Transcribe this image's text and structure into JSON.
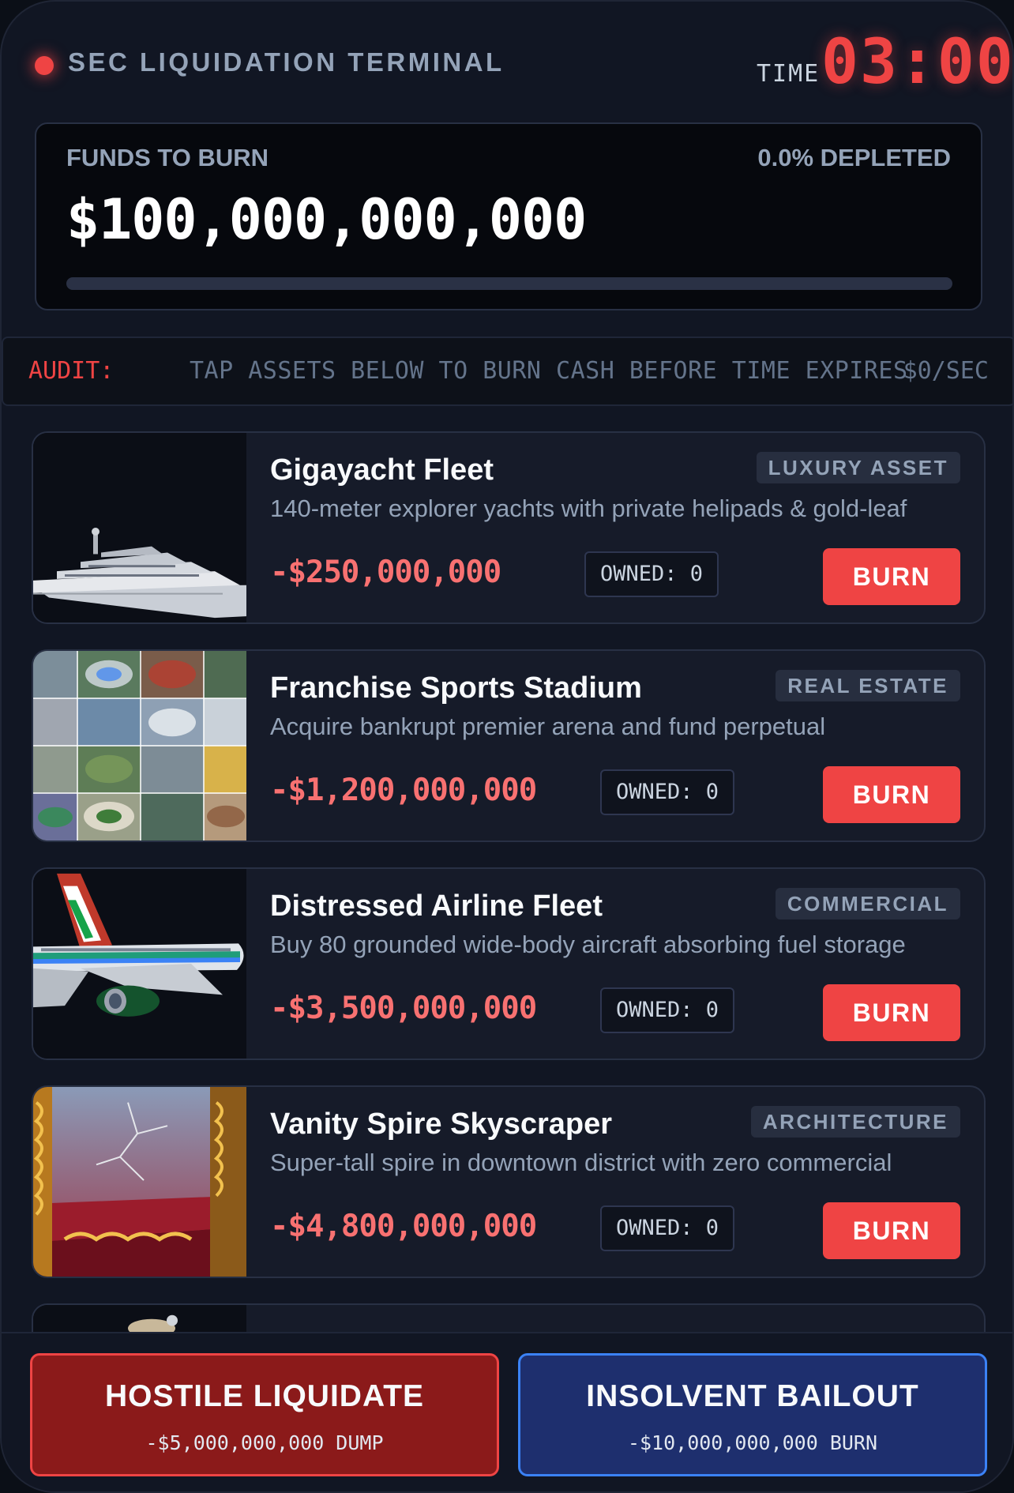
{
  "header": {
    "title": "SEC LIQUIDATION TERMINAL",
    "time_label": "TIME",
    "timer": "03:00"
  },
  "funds": {
    "label": "FUNDS TO BURN",
    "depleted": "0.0% DEPLETED",
    "depleted_fraction": 0.0,
    "amount": "$100,000,000,000"
  },
  "audit": {
    "label": "AUDIT:",
    "message": "TAP ASSETS BELOW TO BURN CASH BEFORE TIME EXPIRES",
    "rate": "$0/SEC"
  },
  "assets": [
    {
      "name": "Gigayacht Fleet",
      "tag": "LUXURY ASSET",
      "description": "140-meter explorer yachts with private helipads & gold-leaf",
      "price": "-$250,000,000",
      "owned": "OWNED: 0",
      "burn_label": "BURN",
      "image_icon": "yacht-image"
    },
    {
      "name": "Franchise Sports Stadium",
      "tag": "REAL ESTATE",
      "description": "Acquire bankrupt premier arena and fund perpetual",
      "price": "-$1,200,000,000",
      "owned": "OWNED: 0",
      "burn_label": "BURN",
      "image_icon": "stadium-collage-image"
    },
    {
      "name": "Distressed Airline Fleet",
      "tag": "COMMERCIAL",
      "description": "Buy 80 grounded wide-body aircraft absorbing fuel storage",
      "price": "-$3,500,000,000",
      "owned": "OWNED: 0",
      "burn_label": "BURN",
      "image_icon": "airliner-image"
    },
    {
      "name": "Vanity Spire Skyscraper",
      "tag": "ARCHITECTURE",
      "description": "Super-tall spire in downtown district with zero commercial",
      "price": "-$4,800,000,000",
      "owned": "OWNED: 0",
      "burn_label": "BURN",
      "image_icon": "ornate-mirror-image"
    }
  ],
  "actions": {
    "hostile": {
      "label": "HOSTILE LIQUIDATE",
      "sub": "-$5,000,000,000 DUMP"
    },
    "bailout": {
      "label": "INSOLVENT BAILOUT",
      "sub": "-$10,000,000,000 BURN"
    }
  },
  "colors": {
    "accent_red": "#ef4444",
    "price_red": "#f87171",
    "bailout_blue": "#3b82f6",
    "background": "#111623"
  }
}
